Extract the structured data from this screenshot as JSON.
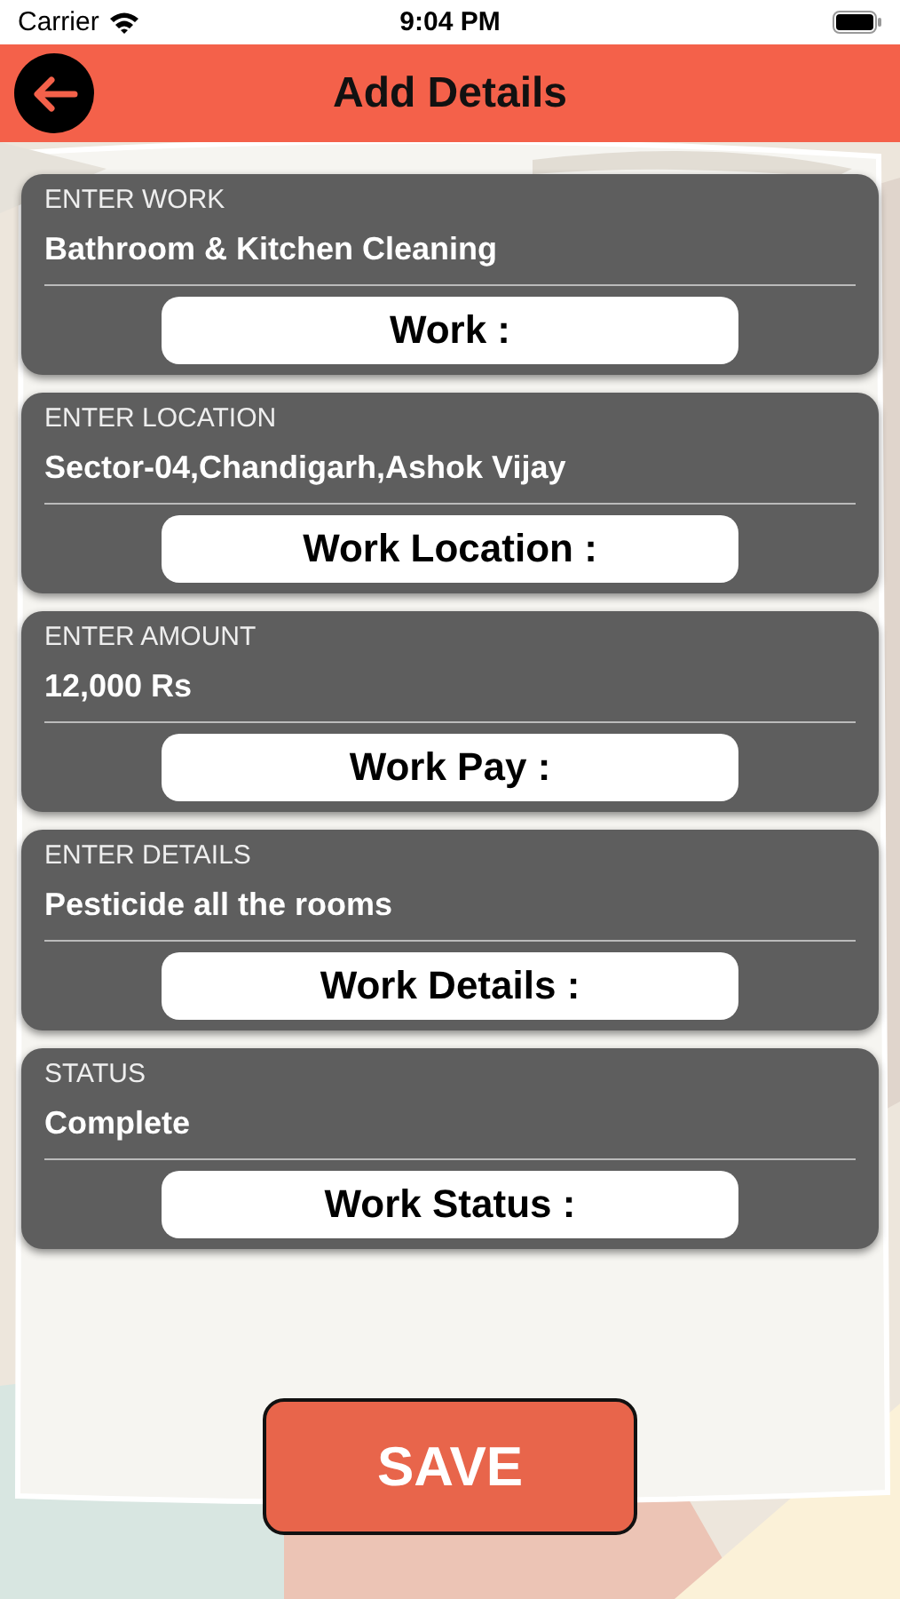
{
  "status_bar": {
    "carrier": "Carrier",
    "time": "9:04 PM"
  },
  "header": {
    "title": "Add Details"
  },
  "fields": [
    {
      "label": "ENTER WORK",
      "value": "Bathroom & Kitchen Cleaning",
      "caption": "Work :"
    },
    {
      "label": "ENTER LOCATION",
      "value": "Sector-04,Chandigarh,Ashok Vijay",
      "caption": "Work Location :"
    },
    {
      "label": "ENTER AMOUNT",
      "value": "12,000 Rs",
      "caption": "Work Pay :"
    },
    {
      "label": "ENTER DETAILS",
      "value": "Pesticide all the rooms",
      "caption": "Work Details :"
    },
    {
      "label": "STATUS",
      "value": "Complete",
      "caption": "Work Status :"
    }
  ],
  "save_button": {
    "label": "SAVE"
  }
}
